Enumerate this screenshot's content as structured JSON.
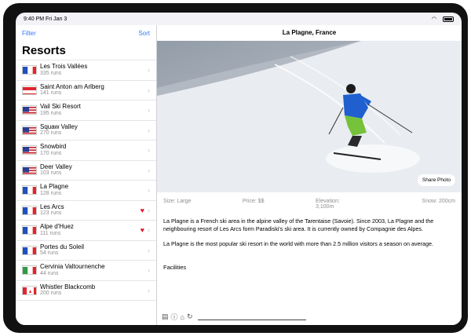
{
  "status": {
    "time_date": "9:40 PM  Fri Jan 3",
    "wifi_icon": "wifi-icon",
    "battery_icon": "battery-icon"
  },
  "sidebar": {
    "filter_label": "Filter",
    "sort_label": "Sort",
    "title": "Resorts",
    "items": [
      {
        "name": "Les Trois Vallées",
        "runs": "335 runs",
        "flag": "fr",
        "favorite": false
      },
      {
        "name": "Saint Anton am Arlberg",
        "runs": "141 runs",
        "flag": "at",
        "favorite": false
      },
      {
        "name": "Vail Ski Resort",
        "runs": "195 runs",
        "flag": "us",
        "favorite": false
      },
      {
        "name": "Squaw Valley",
        "runs": "270 runs",
        "flag": "us",
        "favorite": false
      },
      {
        "name": "Snowbird",
        "runs": "170 runs",
        "flag": "us",
        "favorite": false
      },
      {
        "name": "Deer Valley",
        "runs": "103 runs",
        "flag": "us",
        "favorite": false
      },
      {
        "name": "La Plagne",
        "runs": "128 runs",
        "flag": "fr",
        "favorite": false
      },
      {
        "name": "Les Arcs",
        "runs": "123 runs",
        "flag": "fr",
        "favorite": true
      },
      {
        "name": "Alpe d'Huez",
        "runs": "111 runs",
        "flag": "fr",
        "favorite": true
      },
      {
        "name": "Portes du Soleil",
        "runs": "54 runs",
        "flag": "fr",
        "favorite": false
      },
      {
        "name": "Cervinia Valtournenche",
        "runs": "44 runs",
        "flag": "it",
        "favorite": false
      },
      {
        "name": "Whistler Blackcomb",
        "runs": "200 runs",
        "flag": "ca",
        "favorite": false
      }
    ]
  },
  "detail": {
    "title": "La Plagne, France",
    "share_label": "Share Photo",
    "size": "Size: Large",
    "price": "Price: $$",
    "elevation_label": "Elevation:",
    "elevation_value": "3,100m",
    "snow": "Snow: 200cm",
    "paragraph1": "La Plagne is a French ski area in the alpine valley of the Tarentaise (Savoie). Since 2003, La Plagne and the neighbouring resort of Les Arcs form Paradiski's ski area. It is currently owned by Compagnie des Alpes.",
    "paragraph2": "La Plagne is the most popular ski resort in the world with more than 2.5 million visitors a season on average.",
    "facilities_label": "Facilities"
  },
  "colors": {
    "accent": "#3478f6",
    "heart": "#e0182d"
  }
}
